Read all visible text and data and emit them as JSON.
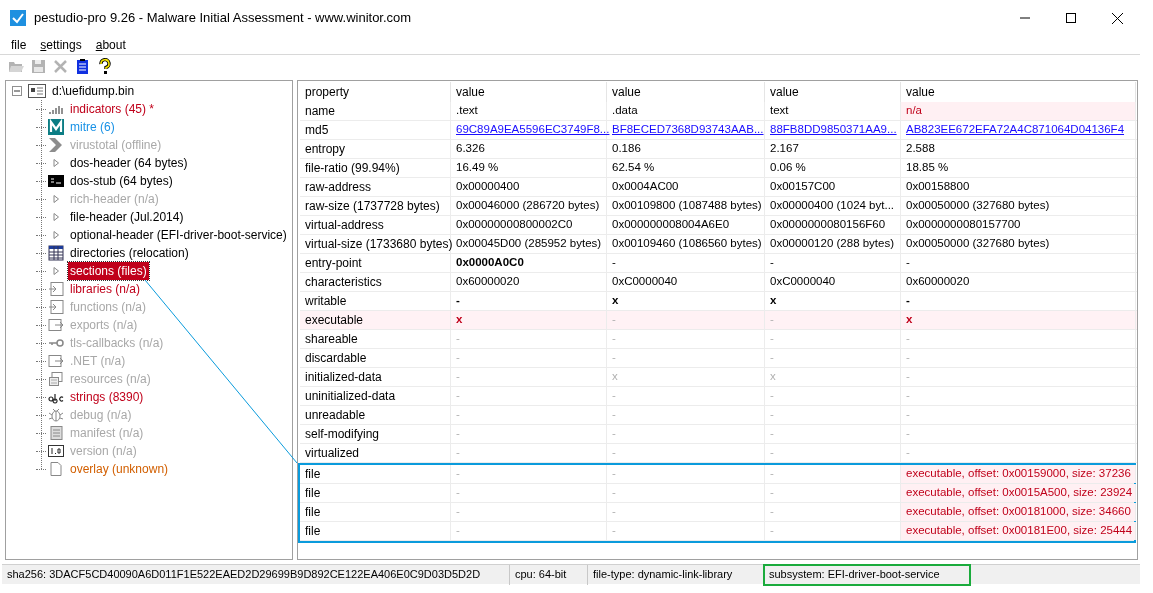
{
  "window": {
    "title": "pestudio-pro 9.26 - Malware Initial Assessment - www.winitor.com"
  },
  "menu": [
    {
      "label": "file",
      "mnemonic": false
    },
    {
      "label": "settings",
      "mnemonic": true
    },
    {
      "label": "about",
      "mnemonic": true
    }
  ],
  "toolbar": [
    {
      "kind": "open",
      "disabled": true
    },
    {
      "kind": "save",
      "disabled": true
    },
    {
      "kind": "cut",
      "disabled": true
    },
    {
      "kind": "clipboard",
      "disabled": false
    },
    {
      "kind": "help",
      "disabled": false
    }
  ],
  "tree": {
    "label": "d:\\uefidump.bin",
    "expanded": true,
    "children": [
      {
        "label": "indicators (45) *",
        "color": "#c0001a",
        "kind": "bars",
        "selected": false
      },
      {
        "label": "mitre (6)",
        "color": "#1791e6",
        "kind": "mitre",
        "selected": false
      },
      {
        "label": "virustotal (offline)",
        "color": "#a8a8a8",
        "kind": "chevron",
        "selected": false
      },
      {
        "label": "dos-header (64 bytes)",
        "color": "#000000",
        "kind": "expander",
        "selected": false
      },
      {
        "label": "dos-stub (64 bytes)",
        "color": "#000000",
        "kind": "console",
        "selected": false
      },
      {
        "label": "rich-header (n/a)",
        "color": "#a8a8a8",
        "kind": "expander",
        "selected": false
      },
      {
        "label": "file-header (Jul.2014)",
        "color": "#000000",
        "kind": "expander",
        "selected": false
      },
      {
        "label": "optional-header (EFI-driver-boot-service)",
        "color": "#000000",
        "kind": "expander",
        "selected": false
      },
      {
        "label": "directories (relocation)",
        "color": "#000000",
        "kind": "table",
        "selected": false
      },
      {
        "label": "sections (files)",
        "color": "#c0001a",
        "kind": "expander",
        "selected": true
      },
      {
        "label": "libraries (n/a)",
        "color": "#c0001a",
        "kind": "import",
        "selected": false
      },
      {
        "label": "functions (n/a)",
        "color": "#a8a8a8",
        "kind": "import",
        "selected": false
      },
      {
        "label": "exports (n/a)",
        "color": "#a8a8a8",
        "kind": "export",
        "selected": false
      },
      {
        "label": "tls-callbacks (n/a)",
        "color": "#a8a8a8",
        "kind": "key",
        "selected": false
      },
      {
        "label": ".NET (n/a)",
        "color": "#a8a8a8",
        "kind": "export",
        "selected": false
      },
      {
        "label": "resources (n/a)",
        "color": "#a8a8a8",
        "kind": "resources",
        "selected": false
      },
      {
        "label": "strings (8390)",
        "color": "#c0001a",
        "kind": "letters",
        "selected": false
      },
      {
        "label": "debug (n/a)",
        "color": "#a8a8a8",
        "kind": "bug",
        "selected": false
      },
      {
        "label": "manifest (n/a)",
        "color": "#a8a8a8",
        "kind": "manifest",
        "selected": false
      },
      {
        "label": "version (n/a)",
        "color": "#a8a8a8",
        "kind": "version",
        "selected": false
      },
      {
        "label": "overlay (unknown)",
        "color": "#d25f00",
        "kind": "file",
        "selected": false
      }
    ]
  },
  "table": {
    "columns": [
      "property",
      "value",
      "value",
      "value",
      "value"
    ],
    "rows": [
      {
        "property": "name",
        "highlighted": false,
        "boxed": false,
        "values": [
          {
            "text": ".text",
            "kind": "plain"
          },
          {
            "text": ".data",
            "kind": "plain"
          },
          {
            "text": "text",
            "kind": "plain"
          },
          {
            "text": "n/a",
            "kind": "alert"
          }
        ]
      },
      {
        "property": "md5",
        "highlighted": false,
        "boxed": false,
        "values": [
          {
            "text": "69C89A9EA5596EC3749F8...",
            "kind": "link"
          },
          {
            "text": "BF8ECED7368D93743AAB...",
            "kind": "link"
          },
          {
            "text": "88FB8DD9850371AA9...",
            "kind": "link"
          },
          {
            "text": "AB823EE672EFA72A4C871064D04136F4",
            "kind": "link"
          }
        ]
      },
      {
        "property": "entropy",
        "highlighted": false,
        "boxed": false,
        "values": [
          {
            "text": "6.326",
            "kind": "plain"
          },
          {
            "text": "0.186",
            "kind": "plain"
          },
          {
            "text": "2.167",
            "kind": "plain"
          },
          {
            "text": "2.588",
            "kind": "plain"
          }
        ]
      },
      {
        "property": "file-ratio (99.94%)",
        "highlighted": false,
        "boxed": false,
        "values": [
          {
            "text": "16.49 %",
            "kind": "plain"
          },
          {
            "text": "62.54 %",
            "kind": "plain"
          },
          {
            "text": "0.06 %",
            "kind": "plain"
          },
          {
            "text": "18.85 %",
            "kind": "plain"
          }
        ]
      },
      {
        "property": "raw-address",
        "highlighted": false,
        "boxed": false,
        "values": [
          {
            "text": "0x00000400",
            "kind": "plain"
          },
          {
            "text": "0x0004AC00",
            "kind": "plain"
          },
          {
            "text": "0x00157C00",
            "kind": "plain"
          },
          {
            "text": "0x00158800",
            "kind": "plain"
          }
        ]
      },
      {
        "property": "raw-size (1737728 bytes)",
        "highlighted": false,
        "boxed": false,
        "values": [
          {
            "text": "0x00046000 (286720 bytes)",
            "kind": "plain"
          },
          {
            "text": "0x00109800 (1087488 bytes)",
            "kind": "plain"
          },
          {
            "text": "0x00000400 (1024 byt...",
            "kind": "plain"
          },
          {
            "text": "0x00050000 (327680 bytes)",
            "kind": "plain"
          }
        ]
      },
      {
        "property": "virtual-address",
        "highlighted": false,
        "boxed": false,
        "values": [
          {
            "text": "0x00000000800002C0",
            "kind": "plain"
          },
          {
            "text": "0x000000008004A6E0",
            "kind": "plain"
          },
          {
            "text": "0x0000000080156F60",
            "kind": "plain"
          },
          {
            "text": "0x0000000080157700",
            "kind": "plain"
          }
        ]
      },
      {
        "property": "virtual-size (1733680 bytes)",
        "highlighted": false,
        "boxed": false,
        "values": [
          {
            "text": "0x00045D00 (285952 bytes)",
            "kind": "plain"
          },
          {
            "text": "0x00109460 (1086560 bytes)",
            "kind": "plain"
          },
          {
            "text": "0x00000120 (288 bytes)",
            "kind": "plain"
          },
          {
            "text": "0x00050000 (327680 bytes)",
            "kind": "plain"
          }
        ]
      },
      {
        "property": "entry-point",
        "highlighted": false,
        "boxed": false,
        "values": [
          {
            "text": "0x0000A0C0",
            "kind": "strong"
          },
          {
            "text": "-",
            "kind": "plain"
          },
          {
            "text": "-",
            "kind": "plain"
          },
          {
            "text": "-",
            "kind": "plain"
          }
        ]
      },
      {
        "property": "characteristics",
        "highlighted": false,
        "boxed": false,
        "values": [
          {
            "text": "0x60000020",
            "kind": "plain"
          },
          {
            "text": "0xC0000040",
            "kind": "plain"
          },
          {
            "text": "0xC0000040",
            "kind": "plain"
          },
          {
            "text": "0x60000020",
            "kind": "plain"
          }
        ]
      },
      {
        "property": "writable",
        "highlighted": false,
        "boxed": false,
        "values": [
          {
            "text": "-",
            "kind": "strong"
          },
          {
            "text": "x",
            "kind": "strong"
          },
          {
            "text": "x",
            "kind": "strong"
          },
          {
            "text": "-",
            "kind": "strong"
          }
        ]
      },
      {
        "property": "executable",
        "highlighted": true,
        "boxed": false,
        "values": [
          {
            "text": "x",
            "kind": "flag"
          },
          {
            "text": "-",
            "kind": "muted"
          },
          {
            "text": "-",
            "kind": "muted"
          },
          {
            "text": "x",
            "kind": "flag"
          }
        ]
      },
      {
        "property": "shareable",
        "highlighted": false,
        "boxed": false,
        "values": [
          {
            "text": "-",
            "kind": "muted"
          },
          {
            "text": "-",
            "kind": "muted"
          },
          {
            "text": "-",
            "kind": "muted"
          },
          {
            "text": "-",
            "kind": "muted"
          }
        ]
      },
      {
        "property": "discardable",
        "highlighted": false,
        "boxed": false,
        "values": [
          {
            "text": "-",
            "kind": "muted"
          },
          {
            "text": "-",
            "kind": "muted"
          },
          {
            "text": "-",
            "kind": "muted"
          },
          {
            "text": "-",
            "kind": "muted"
          }
        ]
      },
      {
        "property": "initialized-data",
        "highlighted": false,
        "boxed": false,
        "values": [
          {
            "text": "-",
            "kind": "muted"
          },
          {
            "text": "x",
            "kind": "muted"
          },
          {
            "text": "x",
            "kind": "muted"
          },
          {
            "text": "-",
            "kind": "muted"
          }
        ]
      },
      {
        "property": "uninitialized-data",
        "highlighted": false,
        "boxed": false,
        "values": [
          {
            "text": "-",
            "kind": "muted"
          },
          {
            "text": "-",
            "kind": "muted"
          },
          {
            "text": "-",
            "kind": "muted"
          },
          {
            "text": "-",
            "kind": "muted"
          }
        ]
      },
      {
        "property": "unreadable",
        "highlighted": false,
        "boxed": false,
        "values": [
          {
            "text": "-",
            "kind": "muted"
          },
          {
            "text": "-",
            "kind": "muted"
          },
          {
            "text": "-",
            "kind": "muted"
          },
          {
            "text": "-",
            "kind": "muted"
          }
        ]
      },
      {
        "property": "self-modifying",
        "highlighted": false,
        "boxed": false,
        "values": [
          {
            "text": "-",
            "kind": "muted"
          },
          {
            "text": "-",
            "kind": "muted"
          },
          {
            "text": "-",
            "kind": "muted"
          },
          {
            "text": "-",
            "kind": "muted"
          }
        ]
      },
      {
        "property": "virtualized",
        "highlighted": false,
        "boxed": false,
        "values": [
          {
            "text": "-",
            "kind": "muted"
          },
          {
            "text": "-",
            "kind": "muted"
          },
          {
            "text": "-",
            "kind": "muted"
          },
          {
            "text": "-",
            "kind": "muted"
          }
        ]
      },
      {
        "property": "file",
        "highlighted": false,
        "boxed": true,
        "values": [
          {
            "text": "-",
            "kind": "muted"
          },
          {
            "text": "-",
            "kind": "muted"
          },
          {
            "text": "-",
            "kind": "muted"
          },
          {
            "text": "executable, offset: 0x00159000, size: 37236",
            "kind": "alert"
          }
        ]
      },
      {
        "property": "file",
        "highlighted": false,
        "boxed": true,
        "values": [
          {
            "text": "-",
            "kind": "muted"
          },
          {
            "text": "-",
            "kind": "muted"
          },
          {
            "text": "-",
            "kind": "muted"
          },
          {
            "text": "executable, offset: 0x0015A500, size: 23924",
            "kind": "alert"
          }
        ]
      },
      {
        "property": "file",
        "highlighted": false,
        "boxed": true,
        "values": [
          {
            "text": "-",
            "kind": "muted"
          },
          {
            "text": "-",
            "kind": "muted"
          },
          {
            "text": "-",
            "kind": "muted"
          },
          {
            "text": "executable, offset: 0x00181000, size: 34660",
            "kind": "alert"
          }
        ]
      },
      {
        "property": "file",
        "highlighted": false,
        "boxed": true,
        "values": [
          {
            "text": "-",
            "kind": "muted"
          },
          {
            "text": "-",
            "kind": "muted"
          },
          {
            "text": "-",
            "kind": "muted"
          },
          {
            "text": "executable, offset: 0x00181E00, size: 25444",
            "kind": "alert"
          }
        ]
      }
    ]
  },
  "status_bar": [
    {
      "text": "sha256: 3DACF5CD40090A6D011F1E522EAED2D29699B9D892CE122EA406E0C9D03D5D2D",
      "highlighted": false
    },
    {
      "text": "cpu: 64-bit",
      "highlighted": false
    },
    {
      "text": "file-type: dynamic-link-library",
      "highlighted": false
    },
    {
      "text": "subsystem: EFI-driver-boot-service",
      "highlighted": true
    }
  ]
}
